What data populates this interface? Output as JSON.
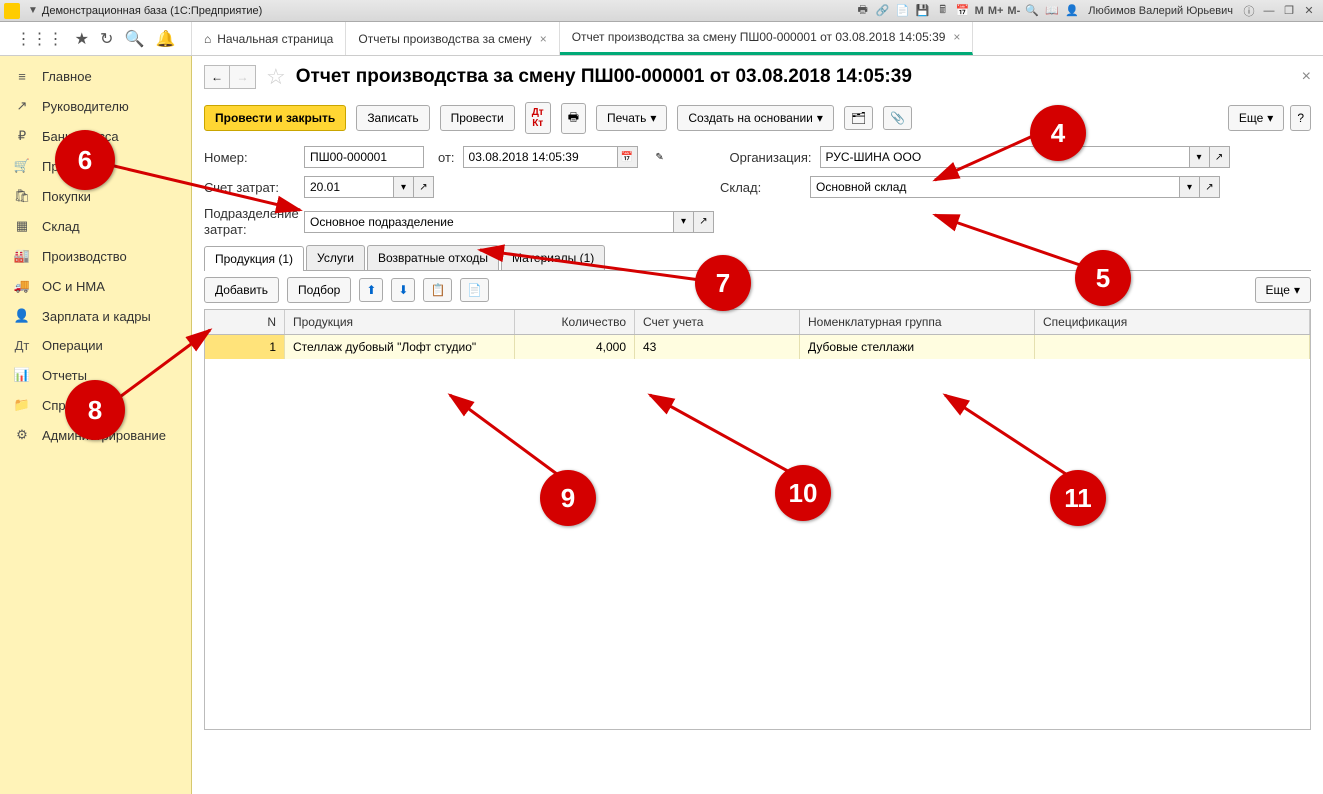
{
  "titlebar": {
    "title": "Демонстрационная база  (1С:Предприятие)",
    "user": "Любимов Валерий Юрьевич",
    "m": "M",
    "mp": "M+",
    "mm": "M-"
  },
  "tabs": {
    "home": "Начальная страница",
    "t1": "Отчеты производства за смену",
    "t2": "Отчет производства за смену ПШ00-000001 от 03.08.2018 14:05:39"
  },
  "sidebar": {
    "items": [
      {
        "icon": "≡",
        "label": "Главное"
      },
      {
        "icon": "↗",
        "label": "Руководителю"
      },
      {
        "icon": "₽",
        "label": "Банк и касса"
      },
      {
        "icon": "🛒",
        "label": "Продажи"
      },
      {
        "icon": "🛍",
        "label": "Покупки"
      },
      {
        "icon": "▦",
        "label": "Склад"
      },
      {
        "icon": "🏭",
        "label": "Производство"
      },
      {
        "icon": "🚚",
        "label": "ОС и НМА"
      },
      {
        "icon": "👤",
        "label": "Зарплата и кадры"
      },
      {
        "icon": "Дт",
        "label": "Операции"
      },
      {
        "icon": "📊",
        "label": "Отчеты"
      },
      {
        "icon": "📁",
        "label": "Справочники"
      },
      {
        "icon": "⚙",
        "label": "Администрирование"
      }
    ]
  },
  "doc": {
    "title": "Отчет производства за смену ПШ00-000001 от 03.08.2018 14:05:39",
    "cmd": {
      "post_close": "Провести и закрыть",
      "write": "Записать",
      "post": "Провести",
      "print": "Печать",
      "create_based": "Создать на основании",
      "more": "Еще"
    },
    "fields": {
      "num_lbl": "Номер:",
      "num": "ПШ00-000001",
      "from_lbl": "от:",
      "date": "03.08.2018 14:05:39",
      "org_lbl": "Организация:",
      "org": "РУС-ШИНА ООО",
      "acct_lbl": "Счет затрат:",
      "acct": "20.01",
      "wh_lbl": "Склад:",
      "wh": "Основной склад",
      "dept_lbl": "Подразделение затрат:",
      "dept": "Основное подразделение"
    },
    "doctabs": {
      "prod": "Продукция (1)",
      "svc": "Услуги",
      "ret": "Возвратные отходы",
      "mat": "Материалы (1)"
    },
    "tbltb": {
      "add": "Добавить",
      "pick": "Подбор",
      "more": "Еще"
    },
    "grid": {
      "h_n": "N",
      "h_prod": "Продукция",
      "h_qty": "Количество",
      "h_acct": "Счет учета",
      "h_nom": "Номенклатурная группа",
      "h_spec": "Спецификация",
      "r_n": "1",
      "r_prod": "Стеллаж дубовый \"Лофт студио\"",
      "r_qty": "4,000",
      "r_acct": "43",
      "r_nom": "Дубовые стеллажи",
      "r_spec": ""
    }
  },
  "anno": {
    "4": "4",
    "5": "5",
    "6": "6",
    "7": "7",
    "8": "8",
    "9": "9",
    "10": "10",
    "11": "11"
  }
}
